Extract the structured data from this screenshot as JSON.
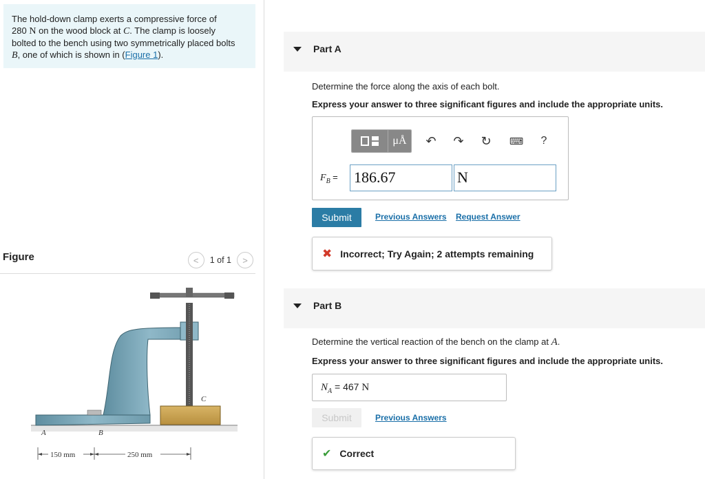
{
  "problem": {
    "text_1": "The hold-down clamp exerts a compressive force of",
    "force_value": "280",
    "force_unit": "N",
    "text_2": "on the wood block at",
    "point_c": "C",
    "text_3": ". The clamp is loosely",
    "text_4": "bolted to the bench using two symmetrically placed bolts",
    "point_b": "B",
    "text_5": ", one of which is shown in (",
    "figure_link": "Figure 1",
    "text_6": ")."
  },
  "figure": {
    "title": "Figure",
    "pager_prev": "<",
    "pager_text": "1 of 1",
    "pager_next": ">",
    "label_a": "A",
    "label_b": "B",
    "label_c": "C",
    "dim_1": "150 mm",
    "dim_2": "250 mm"
  },
  "partA": {
    "label": "Part A",
    "question": "Determine the force along the axis of each bolt.",
    "instruction": "Express your answer to three significant figures and include the appropriate units.",
    "toolbar": {
      "units_label": "μÅ",
      "undo": "↶",
      "redo": "↷",
      "reset": "↻",
      "keyboard": "⌨",
      "help": "?"
    },
    "var_name": "F",
    "var_sub": "B",
    "eq": "=",
    "value": "186.67",
    "unit": "N",
    "submit": "Submit",
    "prev_answers": "Previous Answers",
    "request_answer": "Request Answer",
    "feedback": "Incorrect; Try Again; 2 attempts remaining"
  },
  "partB": {
    "label": "Part B",
    "question": "Determine the vertical reaction of the bench on the clamp at",
    "point": "A",
    "period": ".",
    "instruction": "Express your answer to three significant figures and include the appropriate units.",
    "var_name": "N",
    "var_sub": "A",
    "eq": "=",
    "value": "467",
    "unit": "N",
    "submit": "Submit",
    "prev_answers": "Previous Answers",
    "feedback": "Correct"
  },
  "colors": {
    "accent": "#2b7ca5",
    "link": "#1a6fa8",
    "error": "#d23a2a",
    "success": "#3a9d3a",
    "problem_bg": "#eaf6f9"
  }
}
